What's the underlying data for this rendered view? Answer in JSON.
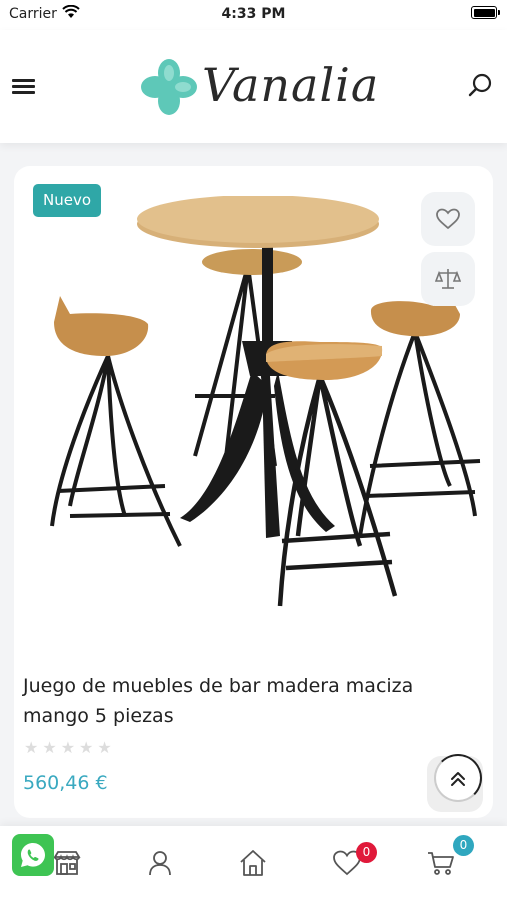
{
  "status_bar": {
    "carrier": "Carrier",
    "time": "4:33 PM",
    "icons": [
      "wifi-icon",
      "battery-icon"
    ]
  },
  "header": {
    "brand_name": "Vanalia",
    "icons": [
      "menu-icon",
      "search-icon"
    ],
    "brand_color": "#5ec8b8"
  },
  "product": {
    "badge": "Nuevo",
    "title": "Juego de muebles de bar madera maciza mango 5 piezas",
    "rating": 0,
    "rating_max": 5,
    "price": "560,46 €",
    "price_color": "#3aa9c0",
    "badge_color": "#2fa7a7",
    "actions": [
      "heart-icon",
      "compare-scale-icon"
    ]
  },
  "bottom_nav": {
    "items": [
      {
        "name": "store",
        "icon": "store-icon"
      },
      {
        "name": "account",
        "icon": "user-icon"
      },
      {
        "name": "home",
        "icon": "home-icon"
      },
      {
        "name": "wishlist",
        "icon": "heart-icon"
      },
      {
        "name": "cart",
        "icon": "cart-icon"
      }
    ],
    "wishlist_count": "0",
    "cart_count": "0"
  },
  "floating": {
    "whatsapp_icon": "whatsapp-icon",
    "scroll_top_icon": "double-chevron-up-icon"
  }
}
